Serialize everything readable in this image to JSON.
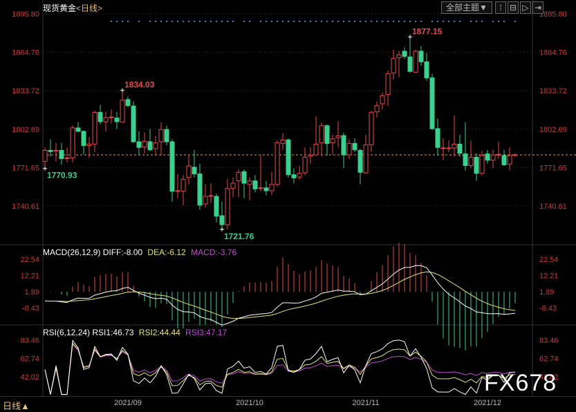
{
  "header": {
    "instrument": "现货黄金",
    "period_open": "<",
    "period": "日线",
    "period_close": ">"
  },
  "toolbar": {
    "theme_label": "全部主题▼",
    "icons": [
      "grid-icon",
      "zoom-out-icon",
      "zoom-in-icon",
      "scroll-end-icon"
    ]
  },
  "bottom": {
    "period_label": "日线▲"
  },
  "watermark": "FX678",
  "macd_header": {
    "name": "MACD(26,12,9)",
    "diff": "DIFF:-8.00",
    "dea": "DEA:-6.12",
    "macd": "MACD:-3.76"
  },
  "rsi_header": {
    "name": "RSI(6,12,24)",
    "rsi1": "RSI1:46.73",
    "rsi2": "RSI2:44.44",
    "rsi3": "RSI3:47.17"
  },
  "colors": {
    "up": "#e84a4a",
    "down": "#3ccf8e",
    "axis": "#c83a3a",
    "diff": "#ffffff",
    "dea": "#e6e67a",
    "rsi1": "#ffffff",
    "rsi2": "#e6e67a",
    "rsi3": "#c050d0",
    "marker": "#3d8fd8"
  },
  "chart_data": [
    {
      "type": "candlestick",
      "title": "现货黄金 日线",
      "y_ticks": [
        "1895.80",
        "1864.76",
        "1833.72",
        "1802.69",
        "1771.65",
        "1740.61"
      ],
      "ylim": [
        1740.61,
        1895.8
      ],
      "x_ticks": [
        {
          "label": "2021/09",
          "index": 15
        },
        {
          "label": "2021/10",
          "index": 37
        },
        {
          "label": "2021/11",
          "index": 58
        },
        {
          "label": "2021/12",
          "index": 80
        }
      ],
      "annotations": [
        {
          "label": "1834.03",
          "index": 14,
          "price": 1834.03,
          "color": "up"
        },
        {
          "label": "1770.93",
          "index": 0,
          "price": 1770.93,
          "color": "down"
        },
        {
          "label": "1721.76",
          "index": 32,
          "price": 1721.76,
          "color": "down"
        },
        {
          "label": "1877.15",
          "index": 66,
          "price": 1877.15,
          "color": "up"
        }
      ],
      "last_price": 1781.9,
      "marker_indices": [
        12,
        13,
        14,
        15,
        17,
        19,
        20,
        21,
        22,
        23,
        24,
        25,
        26,
        27,
        28,
        29,
        30,
        31,
        32,
        33,
        34,
        36,
        37,
        39,
        40,
        41,
        42,
        43,
        44,
        45,
        46,
        47,
        48,
        49,
        50,
        51,
        52,
        53,
        54,
        55,
        56,
        57,
        58,
        59,
        60,
        61,
        62,
        63,
        64,
        65,
        66,
        67,
        68,
        70,
        71,
        72,
        73,
        74,
        75,
        77,
        78,
        79,
        81,
        82,
        83,
        85
      ],
      "ohlc": [
        [
          1776.7,
          1787.9,
          1770.93,
          1785.6
        ],
        [
          1785.6,
          1794.4,
          1780.4,
          1784.5
        ],
        [
          1784.9,
          1791.6,
          1776.7,
          1785.6
        ],
        [
          1785.6,
          1791.6,
          1773.9,
          1778.9
        ],
        [
          1779.0,
          1787.9,
          1775.8,
          1779.5
        ],
        [
          1779.5,
          1805.6,
          1775.8,
          1803.7
        ],
        [
          1803.7,
          1808.3,
          1800.0,
          1800.9
        ],
        [
          1800.9,
          1801.8,
          1782.3,
          1789.4
        ],
        [
          1789.4,
          1796.2,
          1779.5,
          1790.7
        ],
        [
          1790.7,
          1817.6,
          1784.1,
          1816.2
        ],
        [
          1816.2,
          1822.3,
          1806.5,
          1808.7
        ],
        [
          1808.7,
          1816.7,
          1800.9,
          1812.0
        ],
        [
          1812.0,
          1818.6,
          1807.4,
          1812.5
        ],
        [
          1811.7,
          1816.7,
          1802.8,
          1808.7
        ],
        [
          1808.3,
          1834.03,
          1808.3,
          1826.0
        ],
        [
          1826.6,
          1828.8,
          1820.4,
          1821.7
        ],
        [
          1821.4,
          1825.1,
          1791.6,
          1792.5
        ],
        [
          1792.5,
          1800.9,
          1782.3,
          1787.9
        ],
        [
          1788.2,
          1800.0,
          1783.2,
          1792.9
        ],
        [
          1792.5,
          1802.8,
          1785.1,
          1786.0
        ],
        [
          1786.9,
          1797.2,
          1782.3,
          1791.6
        ],
        [
          1792.5,
          1808.3,
          1781.4,
          1802.4
        ],
        [
          1802.4,
          1805.6,
          1789.7,
          1792.5
        ],
        [
          1792.5,
          1794.4,
          1744.1,
          1752.5
        ],
        [
          1752.8,
          1766.5,
          1746.9,
          1753.0
        ],
        [
          1752.5,
          1765.5,
          1741.3,
          1762.2
        ],
        [
          1763.7,
          1781.4,
          1758.1,
          1773.0
        ],
        [
          1772.0,
          1786.0,
          1763.7,
          1766.5
        ],
        [
          1766.5,
          1774.9,
          1737.6,
          1741.3
        ],
        [
          1742.3,
          1758.1,
          1739.5,
          1748.4
        ],
        [
          1748.8,
          1759.0,
          1743.2,
          1749.0
        ],
        [
          1748.4,
          1750.6,
          1727.4,
          1732.4
        ],
        [
          1732.8,
          1744.1,
          1721.76,
          1725.5
        ],
        [
          1725.5,
          1762.7,
          1721.8,
          1754.7
        ],
        [
          1755.0,
          1763.7,
          1747.9,
          1759.0
        ],
        [
          1760.9,
          1770.2,
          1747.9,
          1767.8
        ],
        [
          1768.3,
          1770.2,
          1746.9,
          1759.0
        ],
        [
          1758.0,
          1763.7,
          1745.1,
          1760.9
        ],
        [
          1760.9,
          1765.5,
          1751.6,
          1754.4
        ],
        [
          1755.0,
          1781.4,
          1752.5,
          1755.3
        ],
        [
          1755.3,
          1760.9,
          1749.2,
          1752.9
        ],
        [
          1752.9,
          1768.3,
          1749.7,
          1758.0
        ],
        [
          1758.0,
          1793.5,
          1756.3,
          1791.6
        ],
        [
          1791.2,
          1799.4,
          1786.0,
          1794.0
        ],
        [
          1794.0,
          1795.3,
          1763.7,
          1765.9
        ],
        [
          1765.9,
          1771.1,
          1759.0,
          1763.3
        ],
        [
          1764.0,
          1773.0,
          1761.8,
          1767.0
        ],
        [
          1767.4,
          1787.9,
          1765.5,
          1780.0
        ],
        [
          1780.8,
          1787.9,
          1774.9,
          1781.8
        ],
        [
          1781.9,
          1813.0,
          1781.4,
          1790.6
        ],
        [
          1791.6,
          1808.3,
          1781.4,
          1805.5
        ],
        [
          1805.5,
          1806.5,
          1781.4,
          1791.0
        ],
        [
          1791.6,
          1798.1,
          1782.3,
          1794.9
        ],
        [
          1795.7,
          1809.3,
          1787.9,
          1797.2
        ],
        [
          1797.5,
          1800.0,
          1771.1,
          1781.9
        ],
        [
          1781.9,
          1794.4,
          1778.6,
          1791.2
        ],
        [
          1791.2,
          1795.3,
          1784.1,
          1786.0
        ],
        [
          1785.6,
          1786.9,
          1758.1,
          1767.8
        ],
        [
          1767.4,
          1798.1,
          1766.5,
          1790.1
        ],
        [
          1790.1,
          1817.6,
          1784.1,
          1816.1
        ],
        [
          1816.7,
          1825.1,
          1812.1,
          1821.7
        ],
        [
          1823.2,
          1832.5,
          1818.6,
          1829.7
        ],
        [
          1830.7,
          1850.2,
          1821.4,
          1847.4
        ],
        [
          1848.0,
          1866.9,
          1842.8,
          1859.9
        ],
        [
          1860.4,
          1866.0,
          1844.6,
          1862.7
        ],
        [
          1865.6,
          1868.8,
          1859.5,
          1861.4
        ],
        [
          1861.0,
          1877.15,
          1848.3,
          1849.3
        ],
        [
          1848.7,
          1866.9,
          1848.3,
          1865.6
        ],
        [
          1865.6,
          1869.7,
          1853.9,
          1857.1
        ],
        [
          1857.1,
          1864.2,
          1841.8,
          1844.1
        ],
        [
          1844.1,
          1847.4,
          1801.8,
          1803.1
        ],
        [
          1803.1,
          1811.1,
          1781.4,
          1787.9
        ],
        [
          1787.5,
          1795.3,
          1777.6,
          1787.5
        ],
        [
          1787.5,
          1793.5,
          1784.1,
          1787.5
        ],
        [
          1787.5,
          1813.9,
          1780.4,
          1790.6
        ],
        [
          1790.6,
          1798.1,
          1780.4,
          1783.2
        ],
        [
          1782.7,
          1808.3,
          1769.3,
          1773.3
        ],
        [
          1773.3,
          1793.5,
          1771.1,
          1780.0
        ],
        [
          1780.0,
          1783.2,
          1760.9,
          1767.0
        ],
        [
          1767.0,
          1785.1,
          1765.5,
          1781.4
        ],
        [
          1782.7,
          1786.0,
          1774.9,
          1777.6
        ],
        [
          1777.6,
          1786.0,
          1771.1,
          1781.9
        ],
        [
          1782.3,
          1792.5,
          1778.6,
          1782.3
        ],
        [
          1781.4,
          1786.0,
          1773.0,
          1773.9
        ],
        [
          1774.5,
          1787.9,
          1769.3,
          1781.4
        ],
        [
          1781.8,
          1783.2,
          1780.4,
          1782.0
        ]
      ]
    },
    {
      "type": "macd",
      "params": [
        26,
        12,
        9
      ],
      "y_ticks": [
        "22.54",
        "12.21",
        "1.89",
        "-8.43"
      ],
      "ylim": [
        -16,
        27
      ],
      "series": [
        {
          "name": "DIFF"
        },
        {
          "name": "DEA"
        },
        {
          "name": "MACD"
        }
      ]
    },
    {
      "type": "rsi",
      "params": [
        6,
        12,
        24
      ],
      "y_ticks": [
        "83.46",
        "62.74",
        "42.02"
      ],
      "ylim": [
        20,
        95
      ],
      "series": [
        {
          "name": "RSI1"
        },
        {
          "name": "RSI2"
        },
        {
          "name": "RSI3"
        }
      ]
    }
  ]
}
